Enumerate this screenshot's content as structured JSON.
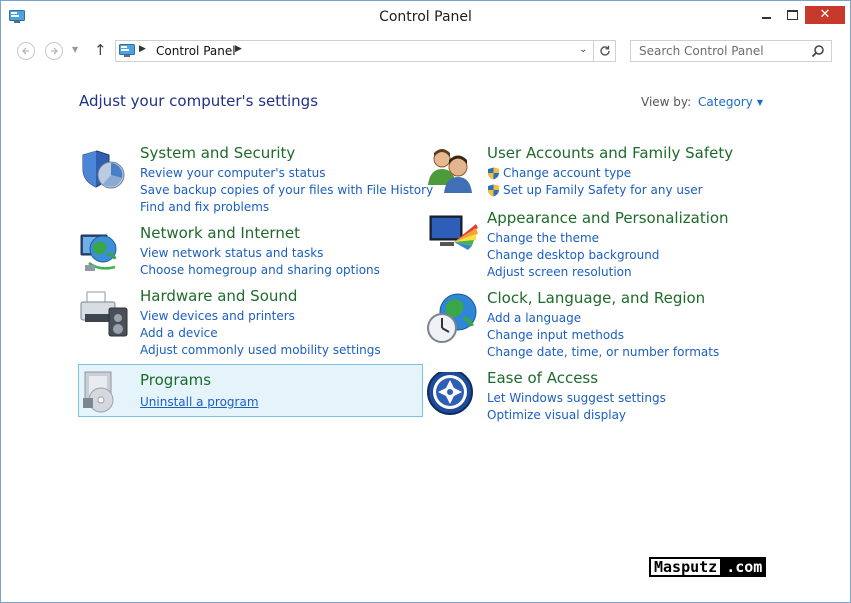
{
  "window": {
    "title": "Control Panel",
    "close_glyph": "✕"
  },
  "nav": {
    "back_icon": "back-arrow-icon",
    "forward_icon": "forward-arrow-icon",
    "up_glyph": "↑",
    "address": "Control Panel",
    "search_placeholder": "Search Control Panel"
  },
  "main": {
    "heading": "Adjust your computer's settings",
    "view_by_label": "View by:",
    "view_by_value": "Category"
  },
  "categories": {
    "system": {
      "title": "System and Security",
      "links": [
        "Review your computer's status",
        "Save backup copies of your files with File History",
        "Find and fix problems"
      ]
    },
    "network": {
      "title": "Network and Internet",
      "links": [
        "View network status and tasks",
        "Choose homegroup and sharing options"
      ]
    },
    "hardware": {
      "title": "Hardware and Sound",
      "links": [
        "View devices and printers",
        "Add a device",
        "Adjust commonly used mobility settings"
      ]
    },
    "programs": {
      "title": "Programs",
      "links": [
        "Uninstall a program"
      ]
    },
    "users": {
      "title": "User Accounts and Family Safety",
      "links": [
        "Change account type",
        "Set up Family Safety for any user"
      ]
    },
    "appearance": {
      "title": "Appearance and Personalization",
      "links": [
        "Change the theme",
        "Change desktop background",
        "Adjust screen resolution"
      ]
    },
    "clock": {
      "title": "Clock, Language, and Region",
      "links": [
        "Add a language",
        "Change input methods",
        "Change date, time, or number formats"
      ]
    },
    "ease": {
      "title": "Ease of Access",
      "links": [
        "Let Windows suggest settings",
        "Optimize visual display"
      ]
    }
  },
  "watermark": {
    "part1": "Masputz",
    "part2": ".com"
  },
  "colors": {
    "category_title": "#1d6b2a",
    "link": "#1a5fc0",
    "heading": "#1e3287",
    "close_button": "#c7392b",
    "highlight_bg": "#e5f3fb",
    "highlight_border": "#7dc2e6"
  }
}
